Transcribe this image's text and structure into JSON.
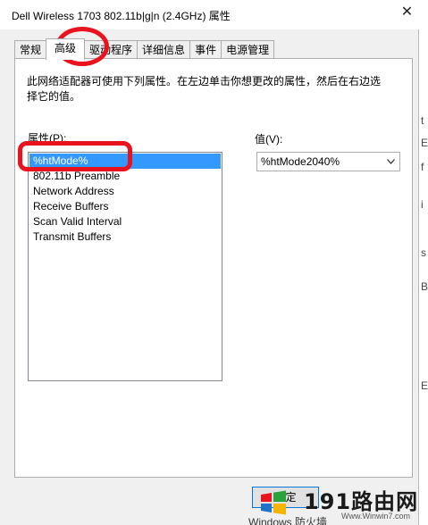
{
  "dialog": {
    "title": "Dell Wireless 1703 802.11b|g|n (2.4GHz) 属性",
    "close_glyph": "✕"
  },
  "tabs": [
    {
      "label": "常规",
      "active": false
    },
    {
      "label": "高级",
      "active": true
    },
    {
      "label": "驱动程序",
      "active": false
    },
    {
      "label": "详细信息",
      "active": false
    },
    {
      "label": "事件",
      "active": false
    },
    {
      "label": "电源管理",
      "active": false
    }
  ],
  "advanced": {
    "description": "此网络适配器可使用下列属性。在左边单击你想更改的属性，然后在右边选择它的值。",
    "property_label": "属性(P):",
    "value_label": "值(V):",
    "properties": [
      "%htMode%",
      "802.11b Preamble",
      "Network Address",
      "Receive Buffers",
      "Scan Valid Interval",
      "Transmit Buffers"
    ],
    "selected_index": 0,
    "selected_value": "%htMode2040%"
  },
  "buttons": {
    "ok_label": "确定"
  },
  "background": {
    "right_chars": [
      "t",
      "E",
      "f",
      "i",
      "s",
      "B",
      "E"
    ],
    "bottom_text": "Windows 防火墙"
  },
  "watermark": {
    "brand": "191路由网",
    "url": "Www.Winwin7.com"
  },
  "colors": {
    "accent": "#0078d7",
    "selection": "#3399ff",
    "annotation": "#e8131e"
  },
  "icons": {
    "close": "close-icon",
    "combo": "chevron-down-icon",
    "logo": "windows-logo-icon"
  }
}
